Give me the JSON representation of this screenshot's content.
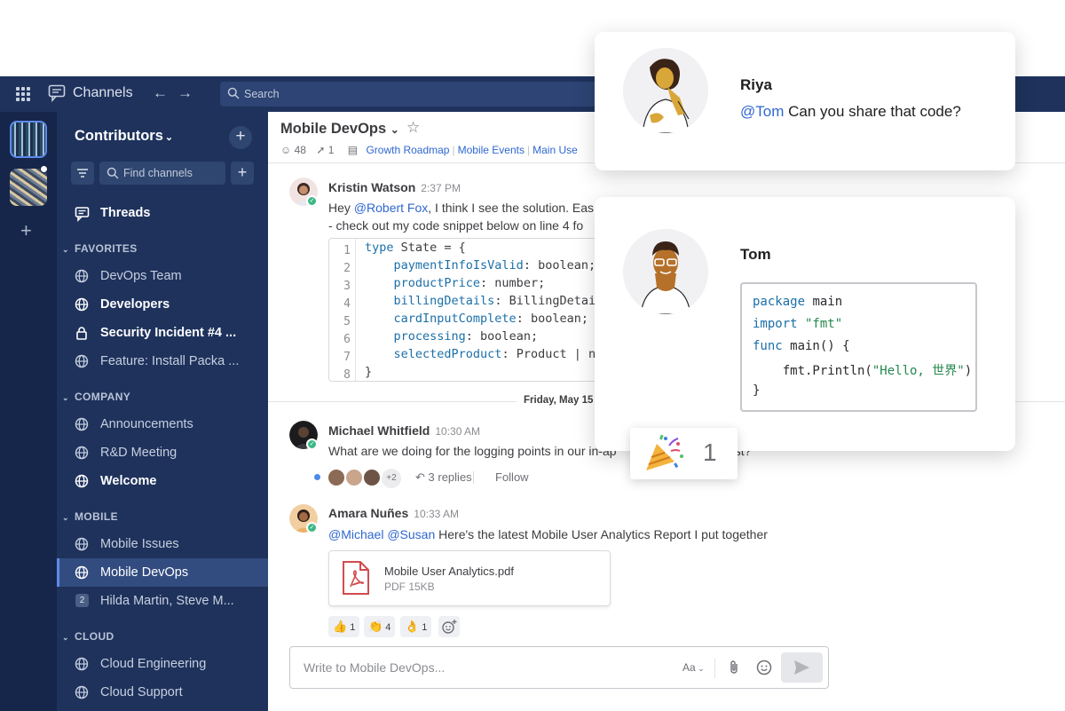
{
  "topbar": {
    "title": "Channels",
    "search_placeholder": "Search"
  },
  "sidebar": {
    "team_name": "Contributors",
    "find_placeholder": "Find channels",
    "threads_label": "Threads",
    "categories": {
      "favorites": "FAVORITES",
      "company": "COMPANY",
      "mobile": "MOBILE",
      "cloud": "CLOUD"
    },
    "favorites": [
      "DevOps Team",
      "Developers",
      "Security Incident #4 ...",
      "Feature: Install Packa ..."
    ],
    "company": [
      "Announcements",
      "R&D Meeting",
      "Welcome"
    ],
    "mobile": [
      "Mobile Issues",
      "Mobile DevOps",
      "Hilda Martin, Steve M..."
    ],
    "mobile_dm_count": "2",
    "cloud": [
      "Cloud Engineering",
      "Cloud Support"
    ]
  },
  "channel": {
    "name": "Mobile DevOps",
    "members": "48",
    "pinned": "1",
    "bookmarks": [
      "Growth Roadmap",
      "Mobile Events",
      "Main Use"
    ]
  },
  "messages": {
    "m1": {
      "author": "Kristin Watson",
      "time": "2:37 PM",
      "prefix": "Hey ",
      "mention": "@Robert Fox",
      "text1": ", I think I see the solution. Eas",
      "text2": "- check out my code snippet below on line 4 fo",
      "code": [
        {
          "ln": "1",
          "a": "type",
          "b": " State = {"
        },
        {
          "ln": "2",
          "a": "    paymentInfoIsValid",
          "b": ": boolean;"
        },
        {
          "ln": "3",
          "a": "    productPrice",
          "b": ": number;"
        },
        {
          "ln": "4",
          "a": "    billingDetails",
          "b": ": BillingDetail"
        },
        {
          "ln": "5",
          "a": "    cardInputComplete",
          "b": ": boolean;"
        },
        {
          "ln": "6",
          "a": "    processing",
          "b": ": boolean;"
        },
        {
          "ln": "7",
          "a": "    selectedProduct",
          "b": ": Product | nu"
        },
        {
          "ln": "8",
          "a": "",
          "b": "}"
        }
      ]
    },
    "date_divider": "Friday, May 15",
    "m2": {
      "author": "Michael Whitfield",
      "time": "10:30 AM",
      "text": "What are we doing for the logging points in our in-ap",
      "text_tail": "est?",
      "more_participants": "+2",
      "replies": "3 replies",
      "follow": "Follow"
    },
    "m3": {
      "author": "Amara Nuñes",
      "time": "10:33 AM",
      "mention1": "@Michael",
      "mention2": "@Susan",
      "text": " Here's the latest Mobile User Analytics Report I put together",
      "file_name": "Mobile User Analytics.pdf",
      "file_meta": "PDF 15KB",
      "reactions": [
        {
          "emoji": "👍",
          "count": "1"
        },
        {
          "emoji": "👏",
          "count": "4"
        },
        {
          "emoji": "👌",
          "count": "1"
        }
      ]
    }
  },
  "composer": {
    "placeholder": "Write to Mobile DevOps...",
    "format_label": "Aa"
  },
  "cards": {
    "riya": {
      "name": "Riya",
      "mention": "@Tom",
      "text": " Can you share that code?"
    },
    "tom": {
      "name": "Tom",
      "code": {
        "l1_kw": "package",
        "l1_rest": " main",
        "l2_kw": "import",
        "l2_str": " \"fmt\"",
        "l3_kw": "func",
        "l3_rest": " main() {",
        "l4_a": "    fmt.Println(",
        "l4_str": "\"Hello, 世界\"",
        "l4_b": ")",
        "l5": "}"
      }
    },
    "reaction_count": "1"
  },
  "colors": {
    "topbar": "#1e325c",
    "sidebar": "#1e325c",
    "teambar": "#16264a",
    "link": "#2f67d0",
    "online": "#3db887"
  }
}
